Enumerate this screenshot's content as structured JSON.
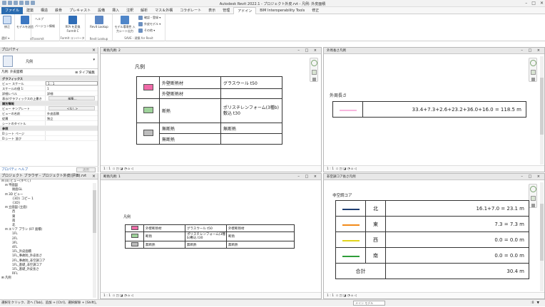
{
  "app": {
    "title": "Autodesk Revit 2022.1 - プロジェクト外皮.rvt - 凡例: 外皮面積"
  },
  "tabs": [
    "ファイル",
    "建築",
    "構造",
    "鉄骨",
    "プレキャスト",
    "設備",
    "挿入",
    "注釈",
    "解析",
    "マス＆外構",
    "コラボレート",
    "表示",
    "管理",
    "アドイン",
    "BIM Interoperability Tools",
    "修正"
  ],
  "active_tab": "アドイン",
  "ribbon": {
    "groups": {
      "select": "選択 ▾",
      "etransmit": "eTransmit",
      "formit": "FormIt コンバータ",
      "lookup": "Revit Lookup",
      "save": "SAVE - 建築 for Revit"
    },
    "buttons": {
      "modify": "修正",
      "etransmit_model": "モデルを送信",
      "help": "ヘルプ",
      "version": "バージョン情報",
      "rfa_formit": "RFA を変換 FormIt C",
      "revit_lookup": "Revit Lookup",
      "model_env": "モデル環境性 入力シート出力",
      "dropdown1": "確認・登録 ▾",
      "dropdown2": "外皮モデル ▾",
      "dropdown3": "その他 ▾"
    }
  },
  "properties": {
    "title": "プロパティ",
    "type_name": "凡例",
    "filter": "凡例: 外皮面積",
    "edit_type": "タイプ編集",
    "rows": [
      {
        "k": "グラフィックス",
        "v": "",
        "cat": true
      },
      {
        "k": "ビュー スケール",
        "v": "1 : 1",
        "input": true
      },
      {
        "k": "スケールの値  1:",
        "v": "1"
      },
      {
        "k": "詳細レベル",
        "v": "詳細"
      },
      {
        "k": "表示/グラフィックスの上書き",
        "v": "編集...",
        "btn": true
      },
      {
        "k": "識別情報",
        "v": "",
        "cat": true
      },
      {
        "k": "ビュー テンプレート",
        "v": "<なし>",
        "btn": true
      },
      {
        "k": "ビューの名前",
        "v": "外皮面積"
      },
      {
        "k": "従属",
        "v": "独立"
      },
      {
        "k": "シートのタイトル",
        "v": ""
      },
      {
        "k": "参照",
        "v": "",
        "cat": true
      },
      {
        "k": "D:シート ページ",
        "v": ""
      },
      {
        "k": "D:シート 並び",
        "v": ""
      }
    ],
    "help_link": "プロパティ ヘルプ",
    "apply": "適用"
  },
  "browser": {
    "title": "プロジェクト ブラウザ - プロジェクト外皮(評価).rvt",
    "items": [
      {
        "label": "[0] ビュー(すべて)",
        "indent": 0,
        "twisty": "⊟"
      },
      {
        "label": "平面図",
        "indent": 1,
        "twisty": "⊟"
      },
      {
        "label": "耐面GL",
        "indent": 3,
        "twisty": ""
      },
      {
        "label": "3D ビュー",
        "indent": 1,
        "twisty": "⊟"
      },
      {
        "label": "{3D} コピー 1",
        "indent": 3,
        "twisty": ""
      },
      {
        "label": "{3D}",
        "indent": 3,
        "twisty": ""
      },
      {
        "label": "立面図 (立面)",
        "indent": 1,
        "twisty": "⊟"
      },
      {
        "label": "西",
        "indent": 3,
        "twisty": ""
      },
      {
        "label": "東",
        "indent": 3,
        "twisty": ""
      },
      {
        "label": "南",
        "indent": 3,
        "twisty": ""
      },
      {
        "label": "北",
        "indent": 3,
        "twisty": ""
      },
      {
        "label": "エリア プラン (07 面積)",
        "indent": 1,
        "twisty": "⊟"
      },
      {
        "label": "1FL",
        "indent": 3,
        "twisty": ""
      },
      {
        "label": "2FL",
        "indent": 3,
        "twisty": ""
      },
      {
        "label": "3FL",
        "indent": 3,
        "twisty": ""
      },
      {
        "label": "4FL",
        "indent": 3,
        "twisty": ""
      },
      {
        "label": "1FL_外皮面積",
        "indent": 3,
        "twisty": ""
      },
      {
        "label": "1FL_事故防_外皮長さ",
        "indent": 3,
        "twisty": ""
      },
      {
        "label": "2FL_事故防_非空調コア",
        "indent": 3,
        "twisty": ""
      },
      {
        "label": "1FL_基礎_非空調コア",
        "indent": 3,
        "twisty": ""
      },
      {
        "label": "1FL_基礎_外皮長さ",
        "indent": 3,
        "twisty": ""
      },
      {
        "label": "RFL",
        "indent": 3,
        "twisty": ""
      },
      {
        "label": "凡例",
        "indent": 0,
        "twisty": "⊞"
      }
    ]
  },
  "views": {
    "v1": {
      "title": "断熱凡例: 2",
      "scale": "1 : 1"
    },
    "v2": {
      "title": "外周長さ凡例",
      "scale": "1 : 1"
    },
    "v3": {
      "title": "断熱凡例: 1",
      "scale": "1 : 1"
    },
    "v4": {
      "title": "非空調コア長さ凡例",
      "scale": "1 : 1"
    }
  },
  "legend_big": {
    "title": "凡例",
    "rows": [
      {
        "color": "#f06aa8",
        "a": "外壁断熱材",
        "b": "グラスウール t50",
        "a2": "外壁断熱材"
      },
      {
        "color": "#9fd39b",
        "a": "断熱",
        "b": "ポリスチレンフォーム(3種b)敷込 t30"
      },
      {
        "color": "#bdbdbd",
        "a": "無断熱",
        "b": "無断熱",
        "a2": "無断熱"
      }
    ]
  },
  "legend_small": {
    "title": "凡例",
    "rows": [
      {
        "color": "#f06aa8",
        "a": "外壁断熱材",
        "b": "グラスウール t50",
        "c": "外壁断熱材"
      },
      {
        "color": "#9fd39b",
        "a": "断熱",
        "b": "ポリスチレンフォーム(3種b)敷込 t30",
        "c": "断熱"
      },
      {
        "color": "#bdbdbd",
        "a": "無断熱",
        "b": "無断熱",
        "c": "無断熱"
      }
    ]
  },
  "perimeter": {
    "label": "外周長さ",
    "color": "#f7b6de",
    "formula": "33.4+7.3+2.6+23.2+36.0+16.0 = 118.5 m"
  },
  "core": {
    "label": "非空調コア",
    "rows": [
      {
        "color": "#1f3f73",
        "dir": "北",
        "formula": "16.1+7.0 = 23.1 m"
      },
      {
        "color": "#f28a1a",
        "dir": "東",
        "formula": "7.3 = 7.3 m"
      },
      {
        "color": "#e2d41c",
        "dir": "西",
        "formula": "0.0 = 0.0 m"
      },
      {
        "color": "#2e9d3a",
        "dir": "南",
        "formula": "0.0 = 0.0 m"
      }
    ],
    "total_label": "合計",
    "total_value": "30.4 m"
  },
  "status": {
    "text": "選択をクリック、次へ [Tab]、追加 + [Ctrl]、選択解除 + [Shift]。",
    "model": "メイン モデル",
    "zero": ":0"
  }
}
